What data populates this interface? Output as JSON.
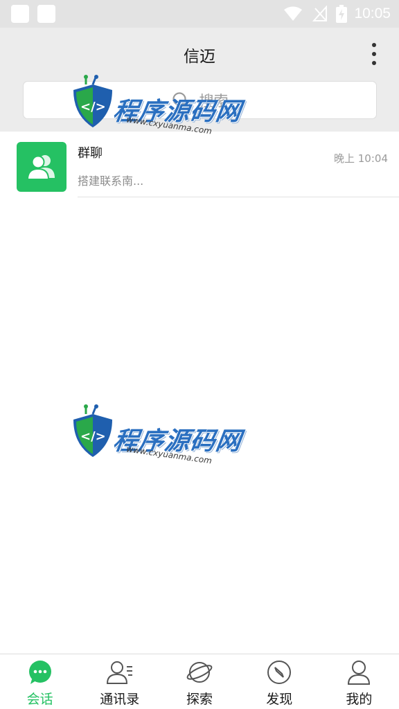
{
  "status_bar": {
    "time": "10:05"
  },
  "header": {
    "title": "信迈"
  },
  "search": {
    "placeholder": "搜索"
  },
  "conversations": [
    {
      "name": "群聊",
      "time": "晚上 10:04",
      "preview": "搭建联系南..."
    }
  ],
  "watermark": {
    "brand": "程序源码网",
    "url": "www.cxyuanma.com"
  },
  "tabs": [
    {
      "label": "会话",
      "icon": "chat-bubble-icon",
      "active": true
    },
    {
      "label": "通讯录",
      "icon": "contacts-icon",
      "active": false
    },
    {
      "label": "探索",
      "icon": "planet-icon",
      "active": false
    },
    {
      "label": "发现",
      "icon": "compass-icon",
      "active": false
    },
    {
      "label": "我的",
      "icon": "user-icon",
      "active": false
    }
  ],
  "colors": {
    "accent": "#25c163",
    "header_bg": "#ececec",
    "status_bg": "#e3e3e3"
  }
}
